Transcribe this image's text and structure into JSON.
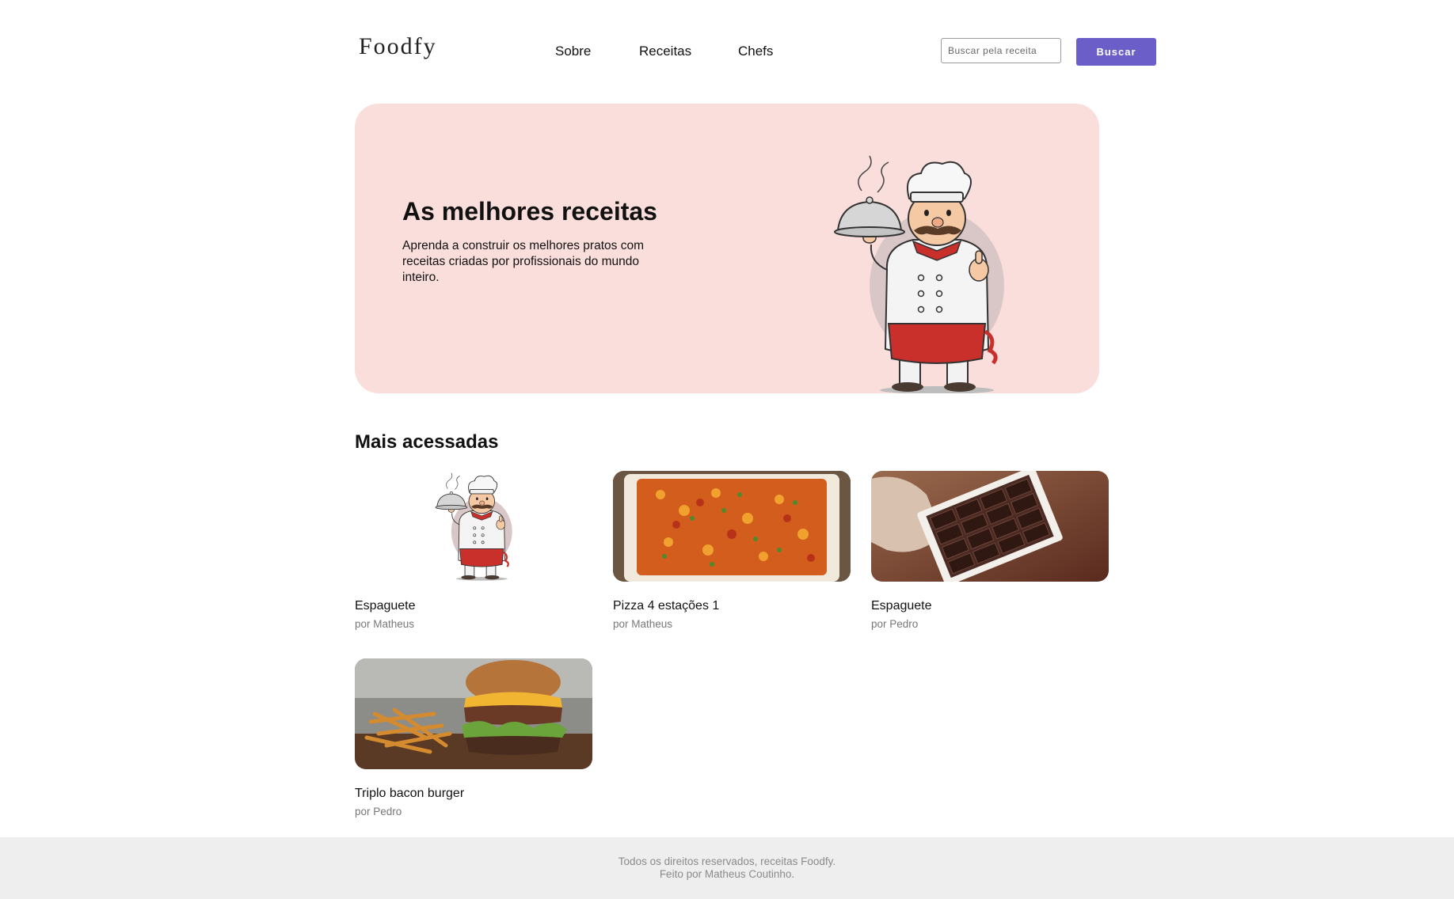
{
  "header": {
    "logo": "Foodfy",
    "nav": [
      "Sobre",
      "Receitas",
      "Chefs"
    ],
    "search_placeholder": "Buscar pela receita",
    "search_button": "Buscar"
  },
  "hero": {
    "title": "As melhores receitas",
    "text": "Aprenda a construir os melhores pratos com receitas criadas por profissionais do mundo inteiro."
  },
  "section": {
    "title": "Mais acessadas",
    "recipes": [
      {
        "title": "Espaguete",
        "author": "por Matheus",
        "image": "chef-illustration"
      },
      {
        "title": "Pizza 4 estações 1",
        "author": "por Matheus",
        "image": "pasta-bake-photo"
      },
      {
        "title": "Espaguete",
        "author": "por Pedro",
        "image": "chocolate-box-photo"
      },
      {
        "title": "Triplo bacon burger",
        "author": "por Pedro",
        "image": "burger-fries-photo"
      }
    ]
  },
  "footer": {
    "line1": "Todos os direitos reservados, receitas Foodfy.",
    "line2": "Feito por Matheus Coutinho."
  },
  "colors": {
    "accent": "#6c5ec9",
    "hero_background": "#fadedb",
    "footer_background": "#eeeeee"
  }
}
